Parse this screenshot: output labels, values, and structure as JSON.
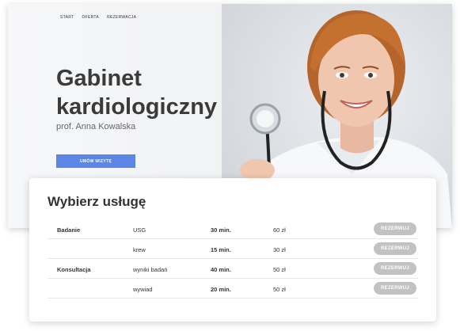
{
  "nav": [
    "START",
    "OFERTA",
    "REZERWACJA"
  ],
  "hero": {
    "title_line1": "Gabinet",
    "title_line2": "kardiologiczny",
    "subtitle": "prof. Anna Kowalska",
    "cta_label": "UMÓW WIZYTĘ"
  },
  "services": {
    "title": "Wybierz usługę",
    "button_label": "REZERWUJ",
    "rows": [
      {
        "category": "Badanie",
        "name": "USG",
        "time": "30 min.",
        "price": "60 zł"
      },
      {
        "category": "",
        "name": "krew",
        "time": "15 min.",
        "price": "30 zł"
      },
      {
        "category": "Konsultacja",
        "name": "wyniki badań",
        "time": "40 min.",
        "price": "50 zł"
      },
      {
        "category": "",
        "name": "wywiad",
        "time": "20 min.",
        "price": "50 zł"
      }
    ]
  },
  "colors": {
    "accent": "#5b86e5",
    "button_disabled": "#c2c2c2"
  },
  "icons": [
    "doctor-photo"
  ]
}
